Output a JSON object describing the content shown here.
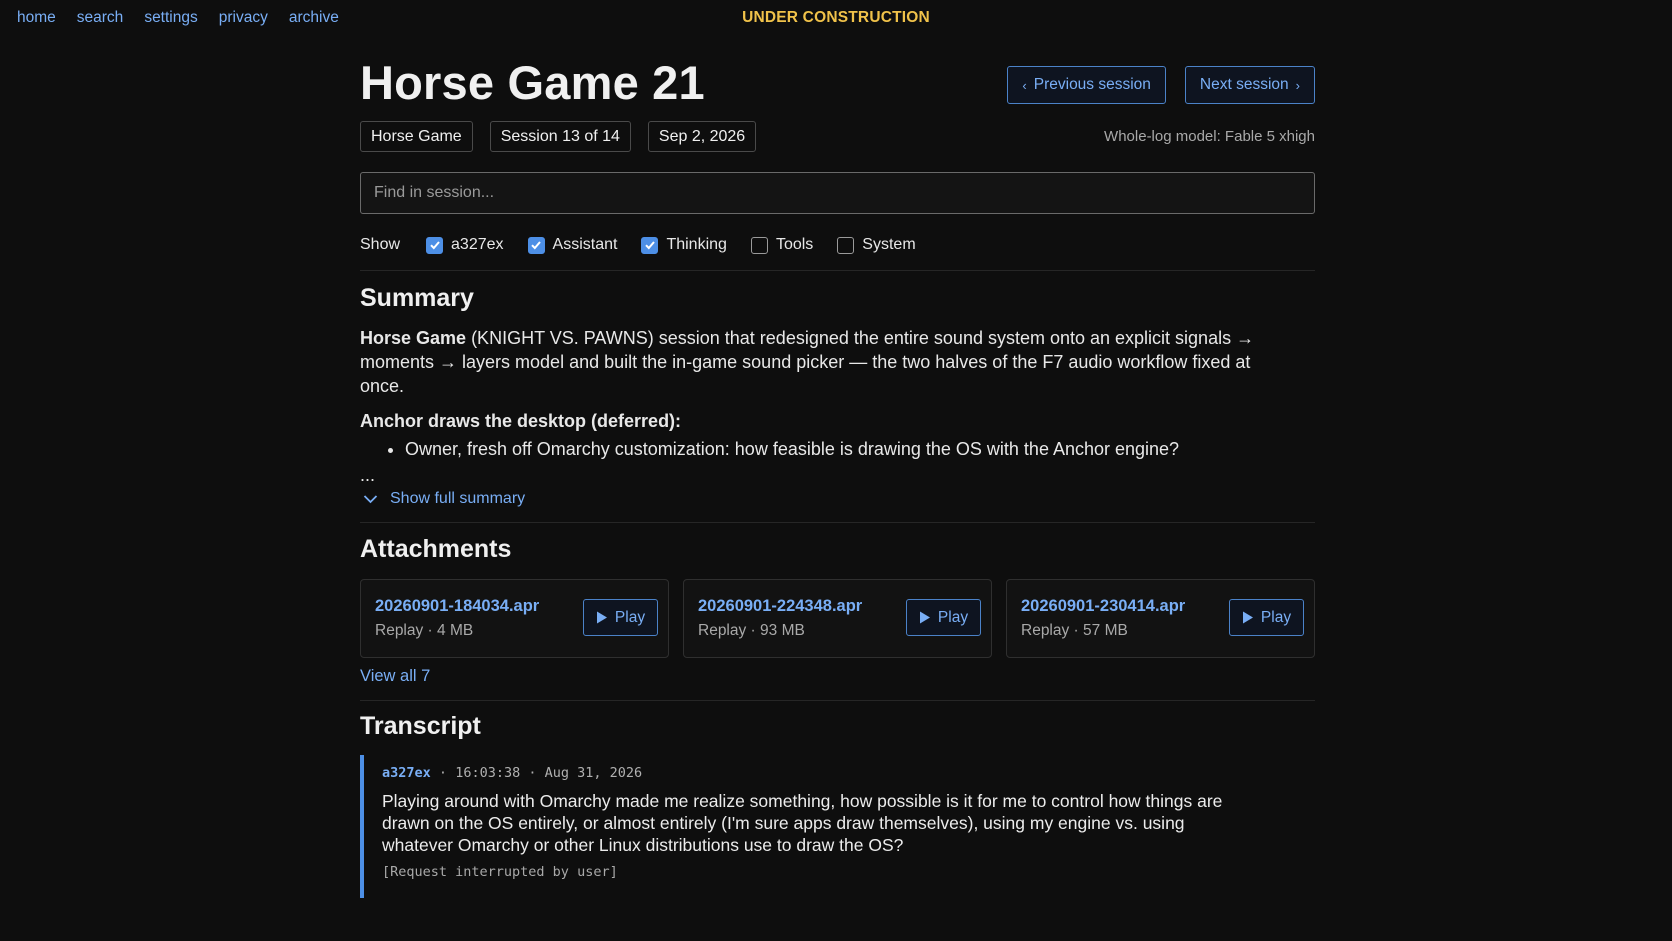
{
  "nav": {
    "links": [
      "home",
      "search",
      "settings",
      "privacy",
      "archive"
    ],
    "banner": "UNDER CONSTRUCTION"
  },
  "header": {
    "title": "Horse Game 21",
    "prev_label": "Previous session",
    "next_label": "Next session",
    "chips": [
      "Horse Game",
      "Session 13 of 14",
      "Sep 2, 2026"
    ],
    "model_note": "Whole-log model: Fable 5 xhigh"
  },
  "search": {
    "placeholder": "Find in session...",
    "value": ""
  },
  "filters": {
    "show_label": "Show",
    "items": [
      {
        "label": "a327ex",
        "checked": true
      },
      {
        "label": "Assistant",
        "checked": true
      },
      {
        "label": "Thinking",
        "checked": true
      },
      {
        "label": "Tools",
        "checked": false
      },
      {
        "label": "System",
        "checked": false
      }
    ]
  },
  "summary": {
    "heading": "Summary",
    "lead_bold": "Horse Game",
    "lead_text": " (KNIGHT VS. PAWNS) session that redesigned the entire sound system onto an explicit signals → moments → layers model and built the in-game sound picker — the two halves of the F7 audio workflow fixed at once.",
    "subheading": "Anchor draws the desktop (deferred):",
    "bullets": [
      "Owner, fresh off Omarchy customization: how feasible is drawing the OS with the Anchor engine?"
    ],
    "ellipsis": "...",
    "toggle_label": "Show full summary"
  },
  "attachments": {
    "heading": "Attachments",
    "play_label": "Play",
    "items": [
      {
        "name": "20260901-184034.apr",
        "meta": "Replay · 4 MB"
      },
      {
        "name": "20260901-224348.apr",
        "meta": "Replay · 93 MB"
      },
      {
        "name": "20260901-230414.apr",
        "meta": "Replay · 57 MB"
      }
    ],
    "view_all": "View all 7"
  },
  "transcript": {
    "heading": "Transcript",
    "messages": [
      {
        "author": "a327ex",
        "time": "16:03:38",
        "date": "Aug 31, 2026",
        "body": "Playing around with Omarchy made me realize something, how possible is it for me to control how things are drawn on the OS entirely, or almost entirely (I'm sure apps draw themselves), using my engine vs. using whatever Omarchy or other Linux distributions use to draw the OS?",
        "note": "[Request interrupted by user]"
      }
    ]
  },
  "colors": {
    "accent": "#4d8fe6",
    "link": "#79aef5",
    "banner": "#f0c24a",
    "background": "#0e0e0e"
  }
}
